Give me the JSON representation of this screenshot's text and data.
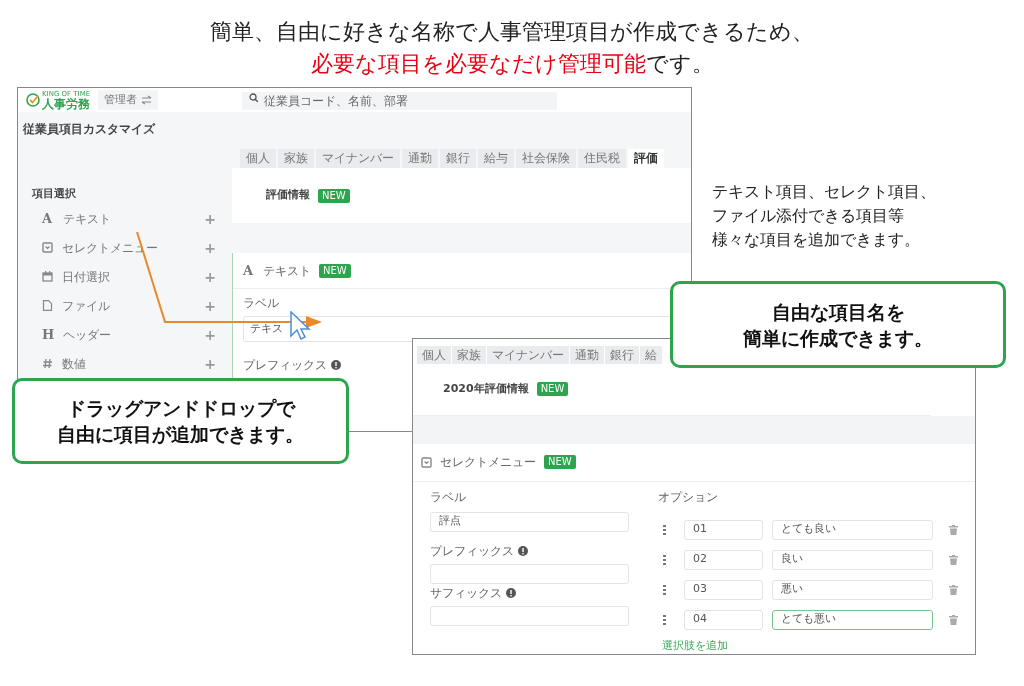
{
  "headline": {
    "line_1": "簡単、自由に好きな名称で人事管理項目が作成できるため、",
    "highlight": "必要な項目を必要なだけ管理可能",
    "line_2_rest": "です。"
  },
  "screen_main": {
    "header": {
      "logo_small": "KING OF TIME",
      "logo": "人事労務",
      "role": "管理者",
      "search_placeholder": "従業員コード、名前、部署"
    },
    "page_title": "従業員項目カスタマイズ",
    "tabs": [
      {
        "label": "個人",
        "selected": false
      },
      {
        "label": "家族",
        "selected": false
      },
      {
        "label": "マイナンバー",
        "selected": false
      },
      {
        "label": "通勤",
        "selected": false
      },
      {
        "label": "銀行",
        "selected": false
      },
      {
        "label": "給与",
        "selected": false
      },
      {
        "label": "社会保険",
        "selected": false
      },
      {
        "label": "住民税",
        "selected": false
      },
      {
        "label": "評価",
        "selected": true
      }
    ],
    "section": {
      "title": "評価情報",
      "badge": "NEW"
    },
    "palette": {
      "heading": "項目選択",
      "items": [
        {
          "kind": "text",
          "icon": "A",
          "label": "テキスト",
          "add": "+"
        },
        {
          "kind": "select",
          "label": "セレクトメニュー",
          "add": "+"
        },
        {
          "kind": "date",
          "label": "日付選択",
          "add": "+"
        },
        {
          "kind": "file",
          "label": "ファイル",
          "add": "+"
        },
        {
          "kind": "header",
          "icon": "H",
          "label": "ヘッダー",
          "add": "+"
        },
        {
          "kind": "number",
          "label": "数値",
          "add": "+"
        }
      ]
    },
    "editor": {
      "kind": "text",
      "icon": "A",
      "title": "テキスト",
      "badge": "NEW",
      "label_caption": "ラベル",
      "label_value": "テキス",
      "prefix_caption": "プレフィックス"
    }
  },
  "screen_select": {
    "tabs": [
      {
        "label": "個人",
        "selected": false
      },
      {
        "label": "家族",
        "selected": false
      },
      {
        "label": "マイナンバー",
        "selected": false
      },
      {
        "label": "通勤",
        "selected": false
      },
      {
        "label": "銀行",
        "selected": false
      },
      {
        "label": "給",
        "selected": false
      }
    ],
    "section": {
      "title": "2020年評価情報",
      "badge": "NEW"
    },
    "editor": {
      "kind": "select",
      "title": "セレクトメニュー",
      "badge": "NEW",
      "label_caption": "ラベル",
      "label_value": "評点",
      "prefix_caption": "プレフィックス",
      "suffix_caption": "サフィックス",
      "options_caption": "オプション",
      "options": [
        {
          "code": "01",
          "label": "とても良い",
          "focused": false
        },
        {
          "code": "02",
          "label": "良い",
          "focused": false
        },
        {
          "code": "03",
          "label": "悪い",
          "focused": false
        },
        {
          "code": "04",
          "label": "とても悪い",
          "focused": true
        }
      ],
      "add_link": "選択肢を追加"
    }
  },
  "side_note": [
    "テキスト項目、セレクト項目、",
    "ファイル添付できる項目等",
    "様々な項目を追加できます。"
  ],
  "callout_right": [
    "自由な項目名を",
    "簡単に作成できます。"
  ],
  "callout_left": [
    "ドラッグアンドドロップで",
    "自由に項目が追加できます。"
  ]
}
